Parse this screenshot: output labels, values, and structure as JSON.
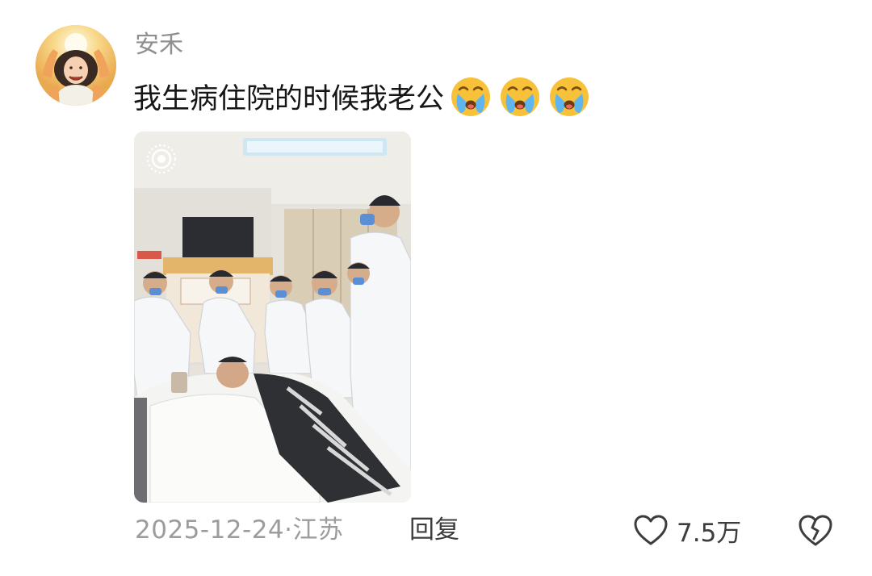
{
  "comment": {
    "username": "安禾",
    "text": "我生病住院的时候我老公",
    "emojis": [
      "crying-emoji",
      "crying-emoji",
      "crying-emoji"
    ],
    "date": "2025-12-24",
    "location_separator": "·",
    "location": "江苏",
    "reply_label": "回复",
    "like_count": "7.5万",
    "icons": {
      "like": "heart-outline-icon",
      "dislike": "broken-heart-icon",
      "live_photo": "live-photo-icon"
    }
  },
  "colors": {
    "username": "#8f8f8f",
    "text": "#161616",
    "meta": "#9c9c9c",
    "action": "#3d3d3d"
  }
}
